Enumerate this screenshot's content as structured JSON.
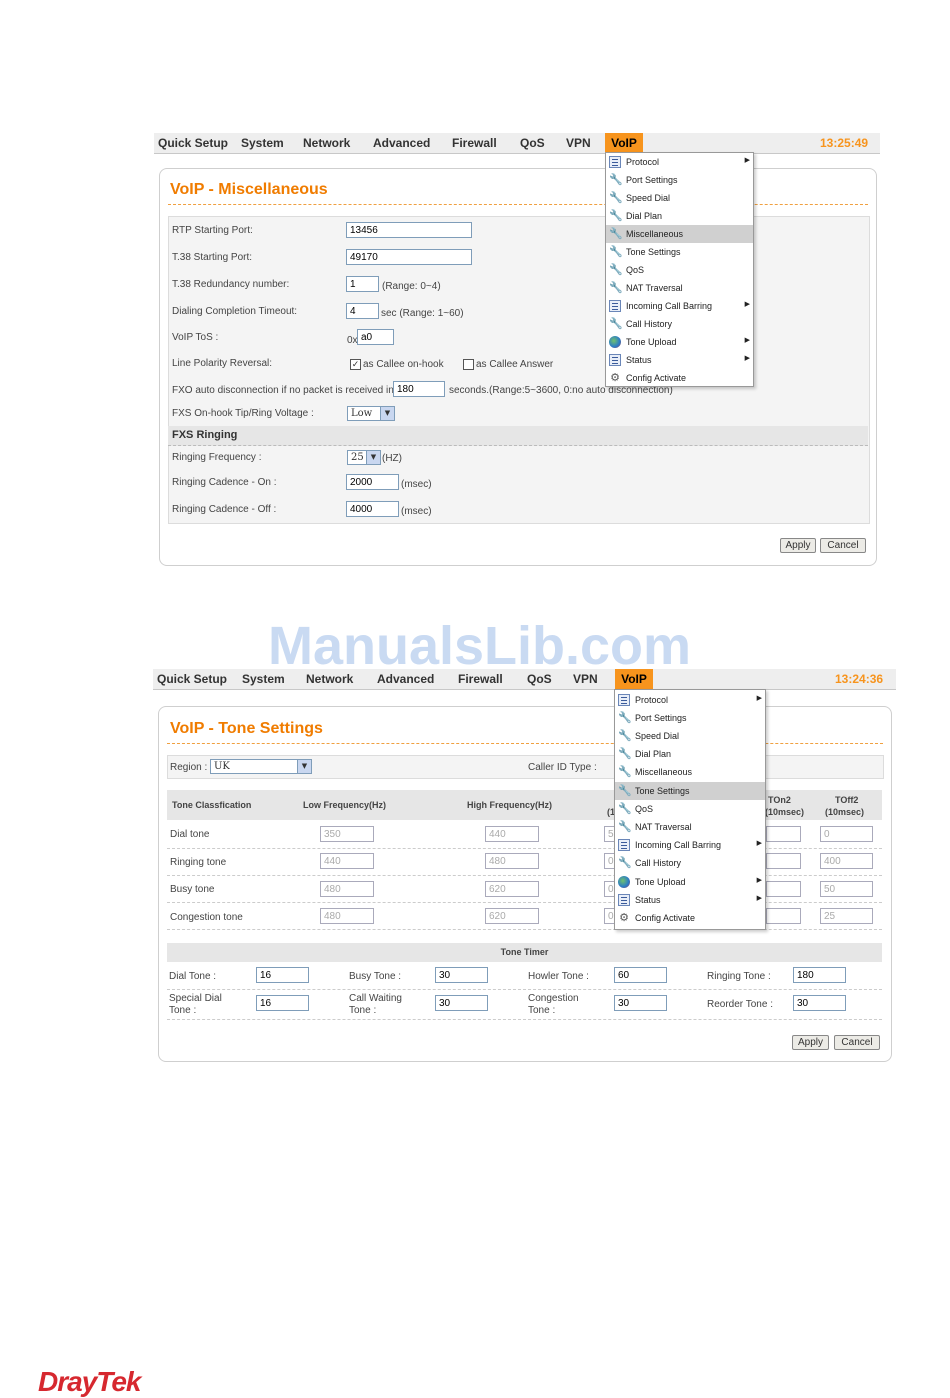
{
  "nav": {
    "items": [
      "Quick Setup",
      "System",
      "Network",
      "Advanced",
      "Firewall",
      "QoS",
      "VPN"
    ],
    "active": "VoIP",
    "time1": "13:25:49",
    "time2": "13:24:36"
  },
  "voip_menu": [
    {
      "label": "Protocol",
      "icon": "list-icon",
      "submenu": true
    },
    {
      "label": "Port Settings",
      "icon": "wrench-icon",
      "submenu": false
    },
    {
      "label": "Speed Dial",
      "icon": "wrench-icon",
      "submenu": false
    },
    {
      "label": "Dial Plan",
      "icon": "wrench-icon",
      "submenu": false
    },
    {
      "label": "Miscellaneous",
      "icon": "wrench-icon",
      "submenu": false
    },
    {
      "label": "Tone Settings",
      "icon": "wrench-icon",
      "submenu": false
    },
    {
      "label": "QoS",
      "icon": "wrench-icon",
      "submenu": false
    },
    {
      "label": "NAT Traversal",
      "icon": "wrench-icon",
      "submenu": false
    },
    {
      "label": "Incoming Call Barring",
      "icon": "list-icon",
      "submenu": true
    },
    {
      "label": "Call History",
      "icon": "wrench-icon",
      "submenu": false
    },
    {
      "label": "Tone Upload",
      "icon": "globe-icon",
      "submenu": true
    },
    {
      "label": "Status",
      "icon": "list-icon",
      "submenu": true
    },
    {
      "label": "Config Activate",
      "icon": "gear-icon",
      "submenu": false
    }
  ],
  "misc": {
    "title": "VoIP - Miscellaneous",
    "rtp_label": "RTP Starting Port:",
    "rtp_value": "13456",
    "t38_label": "T.38 Starting Port:",
    "t38_value": "49170",
    "red_label": "T.38 Redundancy number:",
    "red_value": "1",
    "red_range": "(Range: 0~4)",
    "dct_label": "Dialing Completion Timeout:",
    "dct_value": "4",
    "dct_range": "sec (Range: 1~60)",
    "tos_label": "VoIP ToS :",
    "tos_prefix": "0x",
    "tos_value": "a0",
    "lpr_label": "Line Polarity Reversal:",
    "lpr_opt1": "as Callee on-hook",
    "lpr_opt1_checked": "✓",
    "lpr_opt2": "as Callee Answer",
    "fxo_label": "FXO auto disconnection if no packet is received in",
    "fxo_value": "180",
    "fxo_range": "seconds.(Range:5~3600, 0:no auto disconnection)",
    "fxs_volt_label": "FXS On-hook Tip/Ring Voltage :",
    "fxs_volt_value": "Low",
    "fxs_ringing_header": "FXS Ringing",
    "freq_label": "Ringing Frequency :",
    "freq_value": "25",
    "freq_unit": "(HZ)",
    "con_label": "Ringing Cadence - On :",
    "con_value": "2000",
    "con_unit": "(msec)",
    "coff_label": "Ringing Cadence - Off :",
    "coff_value": "4000",
    "coff_unit": "(msec)",
    "apply": "Apply",
    "cancel": "Cancel"
  },
  "tone": {
    "title": "VoIP - Tone Settings",
    "region_label": "Region :",
    "region_value": "UK",
    "caller_id_label": "Caller ID Type :",
    "headers": {
      "classification": "Tone Classfication",
      "low": "Low Frequency(Hz)",
      "high": "High Frequency(Hz)",
      "ton2a": "TOn2",
      "ton2b": "(10msec)",
      "toff2a": "TOff2",
      "toff2b": "(10msec)",
      "partial": "(1"
    },
    "rows": [
      {
        "name": "Dial tone",
        "low": "350",
        "high": "440",
        "mid": "5",
        "ton2": "",
        "toff2": "0"
      },
      {
        "name": "Ringing tone",
        "low": "440",
        "high": "480",
        "mid": "0",
        "ton2": "",
        "toff2": "400"
      },
      {
        "name": "Busy tone",
        "low": "480",
        "high": "620",
        "mid": "0",
        "ton2": "",
        "toff2": "50"
      },
      {
        "name": "Congestion tone",
        "low": "480",
        "high": "620",
        "mid": "0",
        "ton2": "",
        "toff2": "25"
      }
    ],
    "timer_header": "Tone Timer",
    "timers": [
      {
        "label": "Dial Tone :",
        "value": "16"
      },
      {
        "label": "Busy Tone :",
        "value": "30"
      },
      {
        "label": "Howler Tone :",
        "value": "60"
      },
      {
        "label": "Ringing Tone :",
        "value": "180"
      },
      {
        "label": "Special Dial Tone :",
        "value": "16"
      },
      {
        "label": "Call Waiting Tone :",
        "value": "30"
      },
      {
        "label": "Congestion Tone :",
        "value": "30"
      },
      {
        "label": "Reorder Tone :",
        "value": "30"
      }
    ],
    "apply": "Apply",
    "cancel": "Cancel"
  },
  "watermark": "ManualsLib.com",
  "brand": "DrayTek",
  "colors": {
    "accent": "#f7941d",
    "title": "#f07c00",
    "brand": "#d6282f"
  }
}
